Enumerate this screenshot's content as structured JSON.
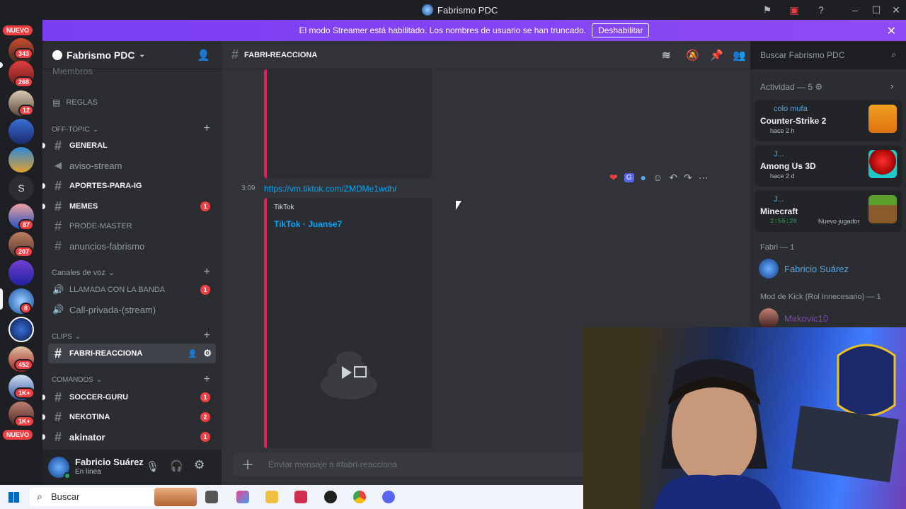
{
  "window": {
    "title": "Fabrismo PDC"
  },
  "servers": {
    "new_label_top": "NUEVO",
    "new_label_bottom": "NUEVO",
    "badges": [
      "343",
      "268",
      "12",
      "87",
      "207",
      "8",
      "452",
      "1K+",
      "1K+"
    ],
    "letter_server": "S"
  },
  "banner": {
    "text": "El modo Streamer está habilitado. Los nombres de usuario se han truncado.",
    "button": "Deshabilitar"
  },
  "sidebar": {
    "server_name": "Fabrismo PDC",
    "partial_item": "Miembros",
    "rules": "REGLAS",
    "categories": {
      "offtopic": "OFF-TOPIC",
      "voice": "Canales de voz",
      "clips": "CLIPS",
      "commands": "COMANDOS"
    },
    "channels": {
      "general": "GENERAL",
      "aviso": "aviso-stream",
      "aportes": "APORTES-PARA-IG",
      "memes": "MEMES",
      "prode": "PRODE-MASTER",
      "anuncios": "anuncios-fabrismo",
      "llamada": "LLAMADA CON LA BANDA",
      "callprivada": "Call-privada-(stream)",
      "fabri": "FABRI-REACCIONA",
      "soccer": "SOCCER-GURU",
      "nekotina": "NEKOTINA",
      "akinator": "akinator"
    },
    "badges": {
      "memes": "1",
      "llamada": "1",
      "soccer": "1",
      "nekotina": "2",
      "akinator": "1"
    }
  },
  "user": {
    "name": "Fabricio Suárez",
    "status": "En línea"
  },
  "chat": {
    "channel": "FABRI-REACCIONA",
    "time": "3:09",
    "link": "https://vm.tiktok.com/ZMDMe1wdh/",
    "embed_provider": "TikTok",
    "embed_title": "TikTok · Juanse7",
    "input_placeholder": "Enviar mensaje a #fabri-reacciona"
  },
  "search": {
    "placeholder": "Buscar Fabrismo PDC"
  },
  "members": {
    "activity_header": "Actividad — 5",
    "activities": [
      {
        "user": "colo mufa",
        "game": "Counter-Strike 2",
        "time": "hace 2 h"
      },
      {
        "user": "J...",
        "game": "Among Us 3D",
        "time": "hace 2 d"
      },
      {
        "user": "J...",
        "game": "Minecraft",
        "time": "2:55:26",
        "extra": "Nuevo jugador"
      }
    ],
    "role_fabri": "Fabri — 1",
    "fabri_member": "Fabricio Suárez",
    "role_mod": "Mod de Kick (Rol Innecesario) — 1",
    "mod_member": "Mirkovic10"
  },
  "taskbar": {
    "search": "Buscar"
  },
  "colors": {
    "accent": "#5865f2",
    "banner": "#8e4bf5",
    "danger": "#f23f43",
    "link": "#00a8fc",
    "online": "#23a55a"
  }
}
